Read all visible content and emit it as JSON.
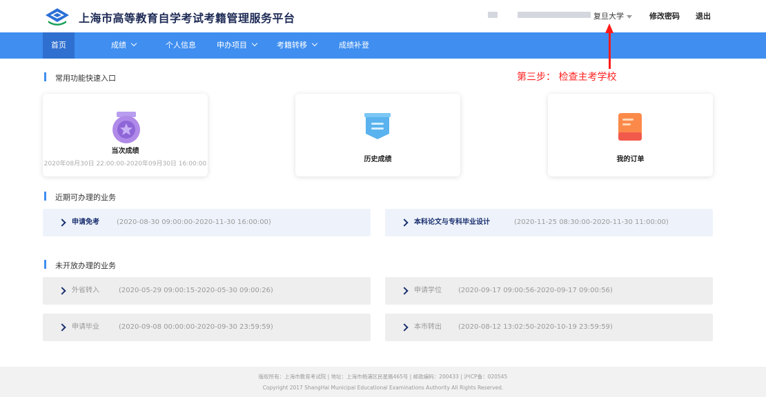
{
  "header": {
    "title": "上海市高等教育自学考试考籍管理服务平台",
    "university": "复旦大学",
    "change_password": "修改密码",
    "logout": "退出"
  },
  "nav": {
    "items": [
      {
        "label": "首页"
      },
      {
        "label": "成绩"
      },
      {
        "label": "个人信息"
      },
      {
        "label": "申办项目"
      },
      {
        "label": "考籍转移"
      },
      {
        "label": "成绩补登"
      }
    ]
  },
  "annotation": {
    "text": "第三步： 检查主考学校"
  },
  "quick_entry": {
    "title": "常用功能快速入口",
    "cards": [
      {
        "label": "当次成绩",
        "sub": "2020年08月30日 22:00:00-2020年09月30日 16:00:00",
        "icon": "medal-icon"
      },
      {
        "label": "历史成绩",
        "icon": "banner-icon"
      },
      {
        "label": "我的订单",
        "icon": "book-icon"
      }
    ]
  },
  "available": {
    "title": "近期可办理的业务",
    "items": [
      {
        "name": "申请免考",
        "period": "(2020-08-30 09:00:00-2020-11-30 16:00:00)"
      },
      {
        "name": "本科论文与专科毕业设计",
        "period": "(2020-11-25 08:30:00-2020-11-30 11:00:00)"
      }
    ]
  },
  "unopened": {
    "title": "未开放办理的业务",
    "items": [
      {
        "name": "外省转入",
        "period": "(2020-05-29 09:00:15-2020-05-30 09:00:26)"
      },
      {
        "name": "申请学位",
        "period": "(2020-09-17 09:00:56-2020-09-17 09:00:56)"
      },
      {
        "name": "申请毕业",
        "period": "(2020-09-08 00:00:00-2020-09-30 23:59:59)"
      },
      {
        "name": "本市转出",
        "period": "(2020-08-12 13:02:50-2020-10-19 23:59:59)"
      }
    ]
  },
  "footer": {
    "line1": "版权所有：上海市教育考试院 | 地址：上海市杨浦区民星路465号 | 邮政编码：200433 | 沪ICP备：020545",
    "line2": "Copyright 2017 ShangHai Municipal Educational Examinations Authority All Rights Reserved."
  },
  "colors": {
    "nav": "#3f8ef0",
    "annotation": "#ff2020",
    "title": "#1d2a55"
  }
}
